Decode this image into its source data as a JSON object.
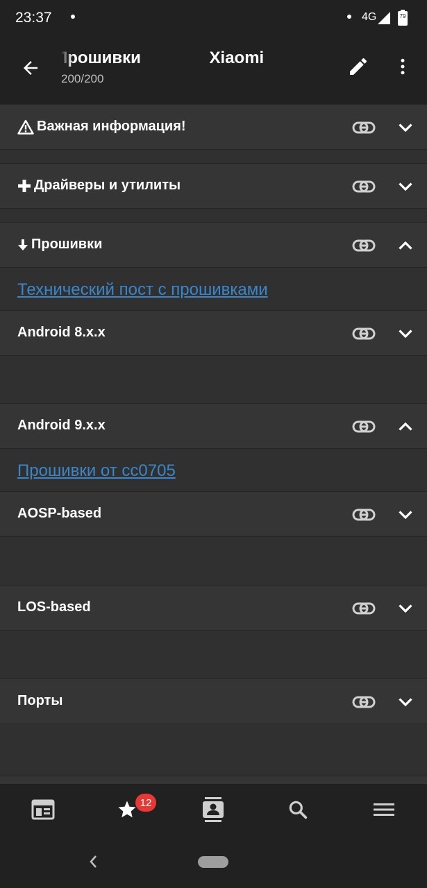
{
  "status_bar": {
    "time": "23:37",
    "network": "4G",
    "battery": "79"
  },
  "app_bar": {
    "title": "Прошивки Xiaomi",
    "subtitle": "200/200"
  },
  "sections": [
    {
      "title": "Важная информация!",
      "icon": "warning-icon",
      "expanded": false
    },
    {
      "title": "Драйверы и утилиты",
      "icon": "plus-icon",
      "expanded": false
    },
    {
      "title": "Прошивки",
      "icon": "arrow-down-icon",
      "expanded": true,
      "link": "Технический пост с прошивками"
    },
    {
      "title": "Android 8.x.x",
      "expanded": false
    },
    {
      "title": "Android 9.x.x",
      "expanded": true,
      "link": "Прошивки от cc0705"
    },
    {
      "title": "AOSP-based",
      "expanded": false
    },
    {
      "title": "LOS-based",
      "expanded": false
    },
    {
      "title": "Порты",
      "expanded": false
    }
  ],
  "bottom_nav": {
    "items": [
      "news-icon",
      "star-icon",
      "contacts-icon",
      "search-icon",
      "menu-icon"
    ],
    "favorites_badge": "12"
  },
  "colors": {
    "link": "#3a86c8",
    "badge": "#e53935",
    "app_bar": "#212121",
    "section_header": "#353535"
  }
}
